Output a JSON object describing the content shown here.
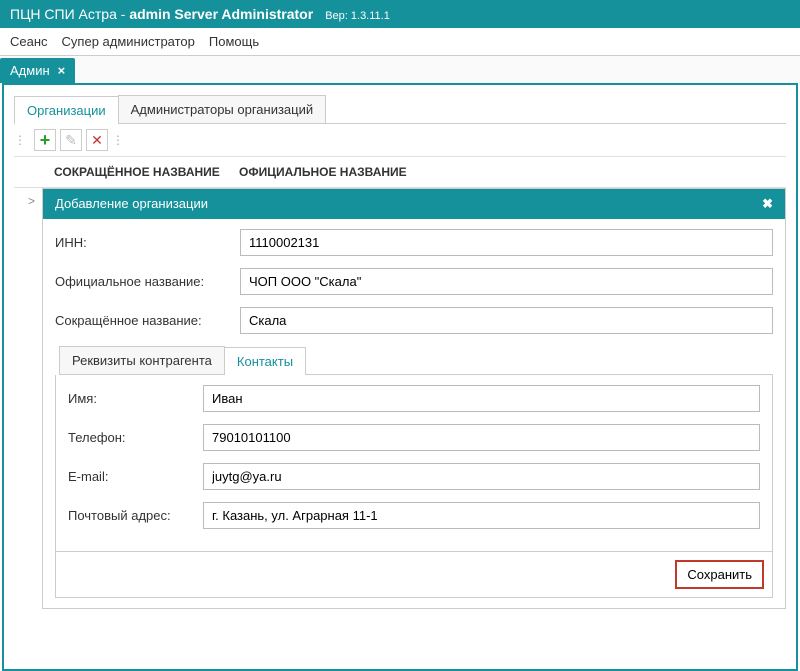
{
  "title": {
    "app": "ПЦН СПИ Астра -",
    "bold": "admin Server Administrator",
    "version_label": "Вер:",
    "version": "1.3.11.1"
  },
  "menu": [
    "Сеанс",
    "Супер администратор",
    "Помощь"
  ],
  "main_tab": {
    "label": "Админ"
  },
  "inner_tabs": {
    "orgs": "Организации",
    "admins": "Администраторы организаций"
  },
  "grid_headers": {
    "short": "СОКРАЩЁННОЕ НАЗВАНИЕ",
    "full": "ОФИЦИАЛЬНОЕ НАЗВАНИЕ"
  },
  "dialog": {
    "title": "Добавление организации",
    "labels": {
      "inn": "ИНН:",
      "full_name": "Официальное название:",
      "short_name": "Сокращённое название:"
    },
    "values": {
      "inn": "1110002131",
      "full_name": "ЧОП ООО \"Скала\"",
      "short_name": "Скала"
    },
    "sub_tabs": {
      "requisites": "Реквизиты контрагента",
      "contacts": "Контакты"
    },
    "contacts": {
      "labels": {
        "name": "Имя:",
        "phone": "Телефон:",
        "email": "E-mail:",
        "address": "Почтовый адрес:"
      },
      "values": {
        "name": "Иван",
        "phone": "79010101100",
        "email": "juytg@ya.ru",
        "address": "г. Казань, ул. Аграрная 11-1"
      }
    },
    "save": "Сохранить"
  }
}
